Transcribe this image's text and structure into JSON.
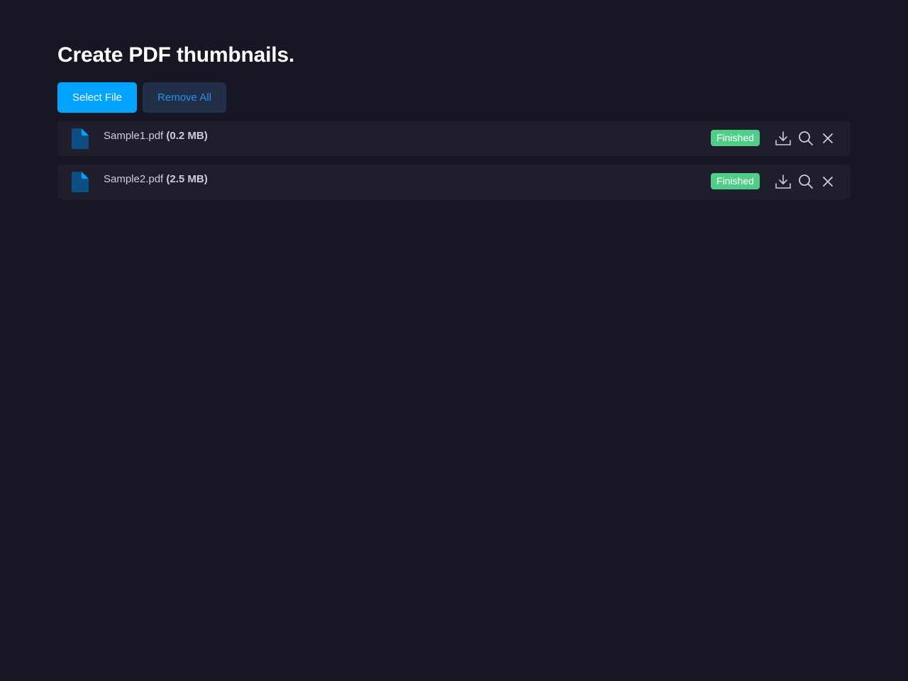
{
  "header": {
    "title": "Create PDF thumbnails."
  },
  "toolbar": {
    "select_label": "Select File",
    "remove_all_label": "Remove All"
  },
  "files": [
    {
      "name": "Sample1.pdf",
      "size": "(0.2 MB)",
      "status": "Finished",
      "icon": "file-icon"
    },
    {
      "name": "Sample2.pdf",
      "size": "(2.5 MB)",
      "status": "Finished",
      "icon": "file-icon"
    }
  ],
  "icons": {
    "download": "download-icon",
    "preview": "search-icon",
    "remove": "close-icon"
  },
  "colors": {
    "background": "#171723",
    "primary": "#00a3ff",
    "secondary_bg": "#212e48",
    "secondary_text": "#2d8fe8",
    "row_bg": "#1e1e2d",
    "success": "#50cd89",
    "file_icon": "#0d4f85"
  }
}
